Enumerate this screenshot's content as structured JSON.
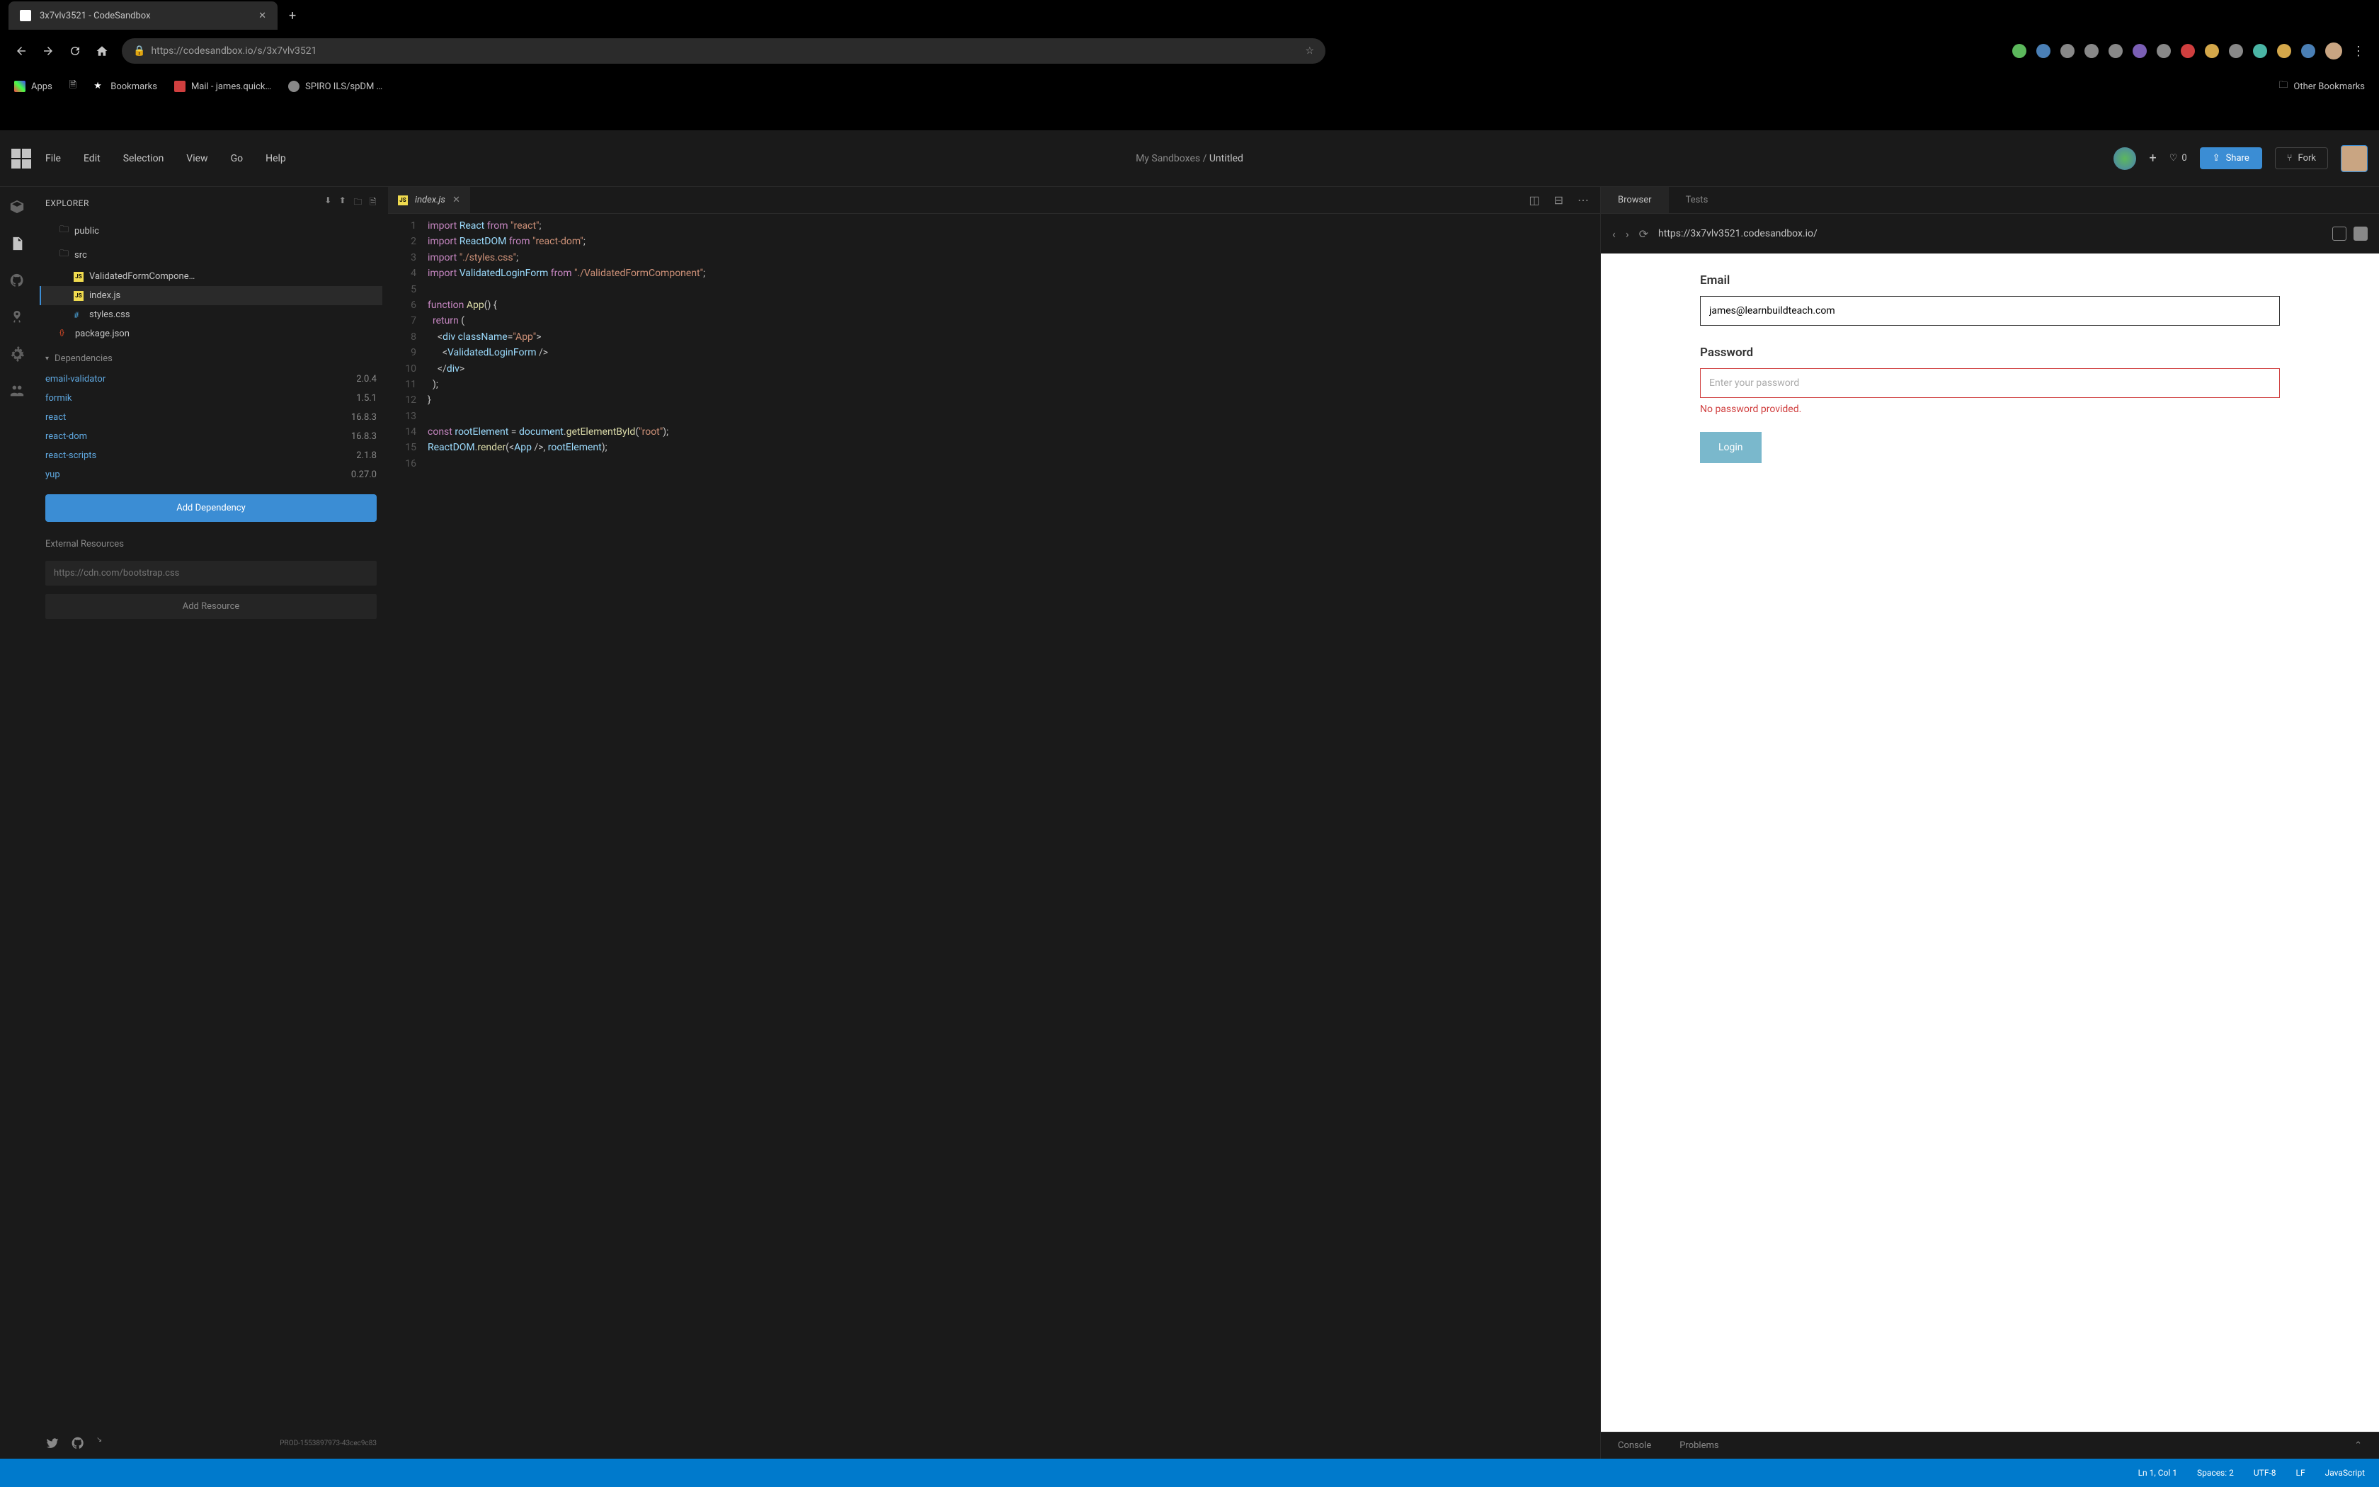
{
  "browser": {
    "tab_title": "3x7vlv3521 - CodeSandbox",
    "url": "https://codesandbox.io/s/3x7vlv3521",
    "bookmarks": {
      "apps": "Apps",
      "bookmarks": "Bookmarks",
      "mail": "Mail - james.quick…",
      "spiro": "SPIRO ILS/spDM …",
      "other": "Other Bookmarks"
    }
  },
  "menubar": {
    "items": [
      "File",
      "Edit",
      "Selection",
      "View",
      "Go",
      "Help"
    ],
    "breadcrumb_prefix": "My Sandboxes / ",
    "breadcrumb_name": "Untitled",
    "likes": "0",
    "share": "Share",
    "fork": "Fork"
  },
  "explorer": {
    "title": "EXPLORER",
    "tree": {
      "public": "public",
      "src": "src",
      "validated": "ValidatedFormCompone…",
      "index": "index.js",
      "styles": "styles.css",
      "package": "package.json"
    },
    "deps_title": "Dependencies",
    "deps": [
      {
        "name": "email-validator",
        "ver": "2.0.4"
      },
      {
        "name": "formik",
        "ver": "1.5.1"
      },
      {
        "name": "react",
        "ver": "16.8.3"
      },
      {
        "name": "react-dom",
        "ver": "16.8.3"
      },
      {
        "name": "react-scripts",
        "ver": "2.1.8"
      },
      {
        "name": "yup",
        "ver": "0.27.0"
      }
    ],
    "add_dep": "Add Dependency",
    "ext_res": "External Resources",
    "res_placeholder": "https://cdn.com/bootstrap.css",
    "add_res": "Add Resource",
    "build_id": "PROD-1553897973-43cec9c83"
  },
  "editor": {
    "tab_name": "index.js",
    "lines": [
      {
        "n": 1,
        "html": "<span class='kw'>import</span> <span class='var'>React</span> <span class='kw'>from</span> <span class='str'>\"react\"</span>;"
      },
      {
        "n": 2,
        "html": "<span class='kw'>import</span> <span class='var'>ReactDOM</span> <span class='kw'>from</span> <span class='str'>\"react-dom\"</span>;"
      },
      {
        "n": 3,
        "html": "<span class='kw'>import</span> <span class='str'>\"./styles.css\"</span>;"
      },
      {
        "n": 4,
        "html": "<span class='kw'>import</span> <span class='var'>ValidatedLoginForm</span> <span class='kw'>from</span> <span class='str'>\"./ValidatedFormComponent\"</span>;"
      },
      {
        "n": 5,
        "html": ""
      },
      {
        "n": 6,
        "html": "<span class='kw'>function</span> <span class='fn'>App</span>() {"
      },
      {
        "n": 7,
        "html": "&nbsp;&nbsp;<span class='kw'>return</span> ("
      },
      {
        "n": 8,
        "html": "&nbsp;&nbsp;&nbsp;&nbsp;&lt;<span class='tag'>div</span> <span class='attr'>className</span>=<span class='str'>\"App\"</span>&gt;"
      },
      {
        "n": 9,
        "html": "&nbsp;&nbsp;&nbsp;&nbsp;&nbsp;&nbsp;&lt;<span class='tag'>ValidatedLoginForm</span> /&gt;"
      },
      {
        "n": 10,
        "html": "&nbsp;&nbsp;&nbsp;&nbsp;&lt;/<span class='tag'>div</span>&gt;"
      },
      {
        "n": 11,
        "html": "&nbsp;&nbsp;);"
      },
      {
        "n": 12,
        "html": "}"
      },
      {
        "n": 13,
        "html": ""
      },
      {
        "n": 14,
        "html": "<span class='kw'>const</span> <span class='var'>rootElement</span> = <span class='var'>document</span>.<span class='fn'>getElementById</span>(<span class='str'>\"root\"</span>);"
      },
      {
        "n": 15,
        "html": "<span class='var'>ReactDOM</span>.<span class='fn'>render</span>(&lt;<span class='tag'>App</span> /&gt;, <span class='var'>rootElement</span>);"
      },
      {
        "n": 16,
        "html": ""
      }
    ]
  },
  "preview": {
    "tab_browser": "Browser",
    "tab_tests": "Tests",
    "url": "https://3x7vlv3521.codesandbox.io/",
    "form": {
      "email_label": "Email",
      "email_value": "james@learnbuildteach.com",
      "password_label": "Password",
      "password_placeholder": "Enter your password",
      "error": "No password provided.",
      "login": "Login"
    }
  },
  "console": {
    "console": "Console",
    "problems": "Problems"
  },
  "status": {
    "pos": "Ln 1, Col 1",
    "spaces": "Spaces: 2",
    "enc": "UTF-8",
    "eol": "LF",
    "lang": "JavaScript"
  }
}
